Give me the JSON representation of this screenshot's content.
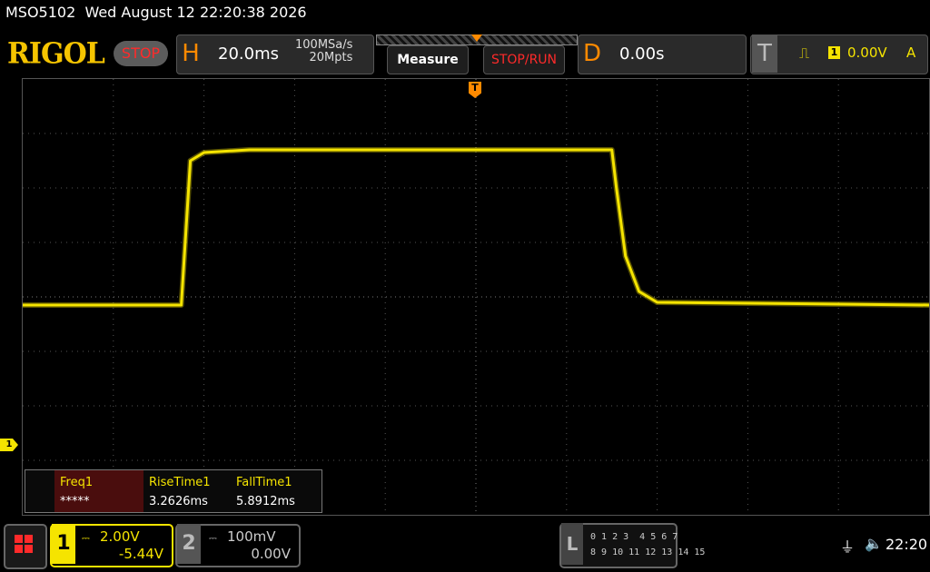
{
  "status": {
    "model": "MSO5102",
    "datetime": "Wed August 12 22:20:38 2026"
  },
  "header": {
    "brand": "RIGOL",
    "run_state": "STOP",
    "timebase": {
      "letter": "H",
      "value": "20.0ms",
      "sample_rate": "100MSa/s",
      "memory_depth": "20Mpts"
    },
    "measure_label": "Measure",
    "stoprun_label": "STOP/RUN",
    "delay": {
      "letter": "D",
      "value": "0.00s"
    },
    "trigger": {
      "letter": "T",
      "source": "1",
      "level": "0.00V",
      "mode": "A"
    }
  },
  "markers": {
    "channel1": "1",
    "trigger": "T"
  },
  "chart_data": {
    "type": "line",
    "series": [
      {
        "x": [
          -100,
          -65,
          -63,
          -60,
          -50,
          0,
          30,
          31,
          33,
          36,
          40,
          100
        ],
        "y": [
          -0.3,
          -0.3,
          5.0,
          5.3,
          5.4,
          5.4,
          5.4,
          4.0,
          1.5,
          0.2,
          -0.2,
          -0.3
        ]
      }
    ],
    "xlim": [
      -100,
      100
    ],
    "ylim": [
      -8,
      8
    ],
    "grid": true,
    "color": "#f5e400"
  },
  "measurements": [
    {
      "name": "Freq1",
      "value": "*****"
    },
    {
      "name": "RiseTime1",
      "value": "3.2626ms"
    },
    {
      "name": "FallTime1",
      "value": "5.8912ms"
    }
  ],
  "channels": {
    "ch1": {
      "num": "1",
      "coupling": "⎓",
      "scale": "2.00V",
      "offset": "-5.44V",
      "color": "#f5e400"
    },
    "ch2": {
      "num": "2",
      "coupling": "⎓",
      "scale": "100mV",
      "offset": "0.00V",
      "color": "#888888"
    }
  },
  "logic": {
    "letter": "L",
    "row1": "0 1 2 3  4 5 6 7",
    "row2": "8 9 10 11 12 13 14 15"
  },
  "system": {
    "clock": "22:20",
    "usb_icon": "usb-icon",
    "speaker_icon": "speaker-muted-icon"
  }
}
